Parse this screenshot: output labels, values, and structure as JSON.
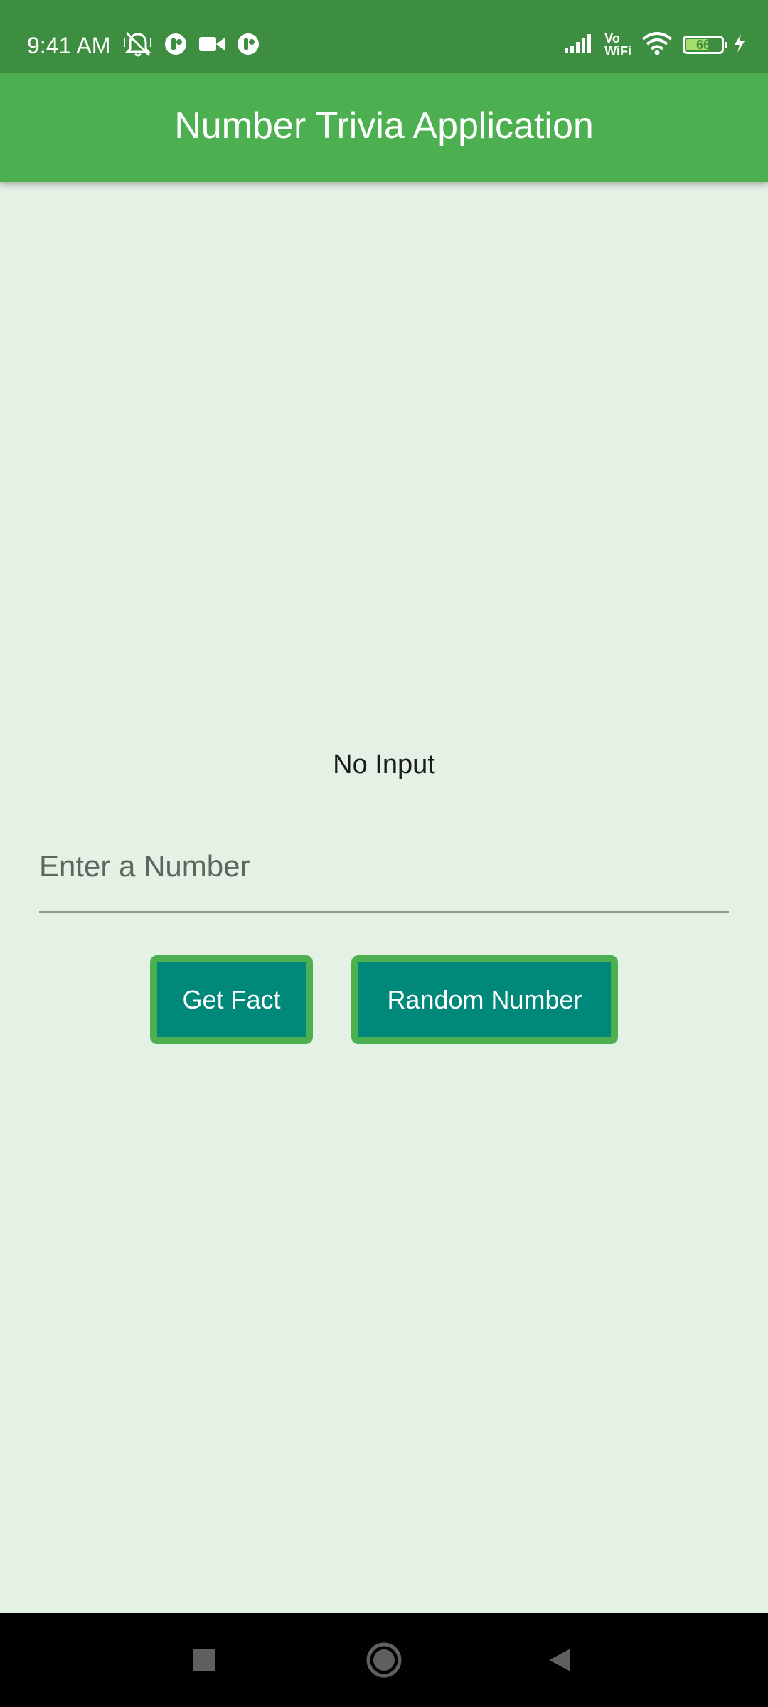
{
  "status_bar": {
    "time": "9:41 AM",
    "left_icons": [
      "silent-bell-icon",
      "notification-app-icon",
      "video-camera-icon",
      "notification-app-icon"
    ],
    "right_icons": [
      "cellular-signal-icon",
      "vowifi-icon",
      "wifi-icon",
      "battery-icon",
      "charging-bolt-icon"
    ],
    "vowifi_top": "Vo",
    "vowifi_bottom": "WiFi",
    "battery_percent": "66",
    "battery_level": 0.66
  },
  "app_bar": {
    "title": "Number Trivia Application"
  },
  "main": {
    "result_text": "No Input",
    "input": {
      "placeholder": "Enter a Number",
      "value": ""
    },
    "buttons": {
      "get_fact": "Get Fact",
      "random_number": "Random Number"
    }
  },
  "nav_bar": {
    "icons": [
      "recents-square-icon",
      "home-circle-icon",
      "back-triangle-icon"
    ]
  },
  "colors": {
    "status_bar": "#3e8e41",
    "app_bar": "#4caf50",
    "background": "#e4f1e5",
    "button_fill": "#00897b",
    "button_border": "#4caf50",
    "nav_bar": "#000000"
  }
}
